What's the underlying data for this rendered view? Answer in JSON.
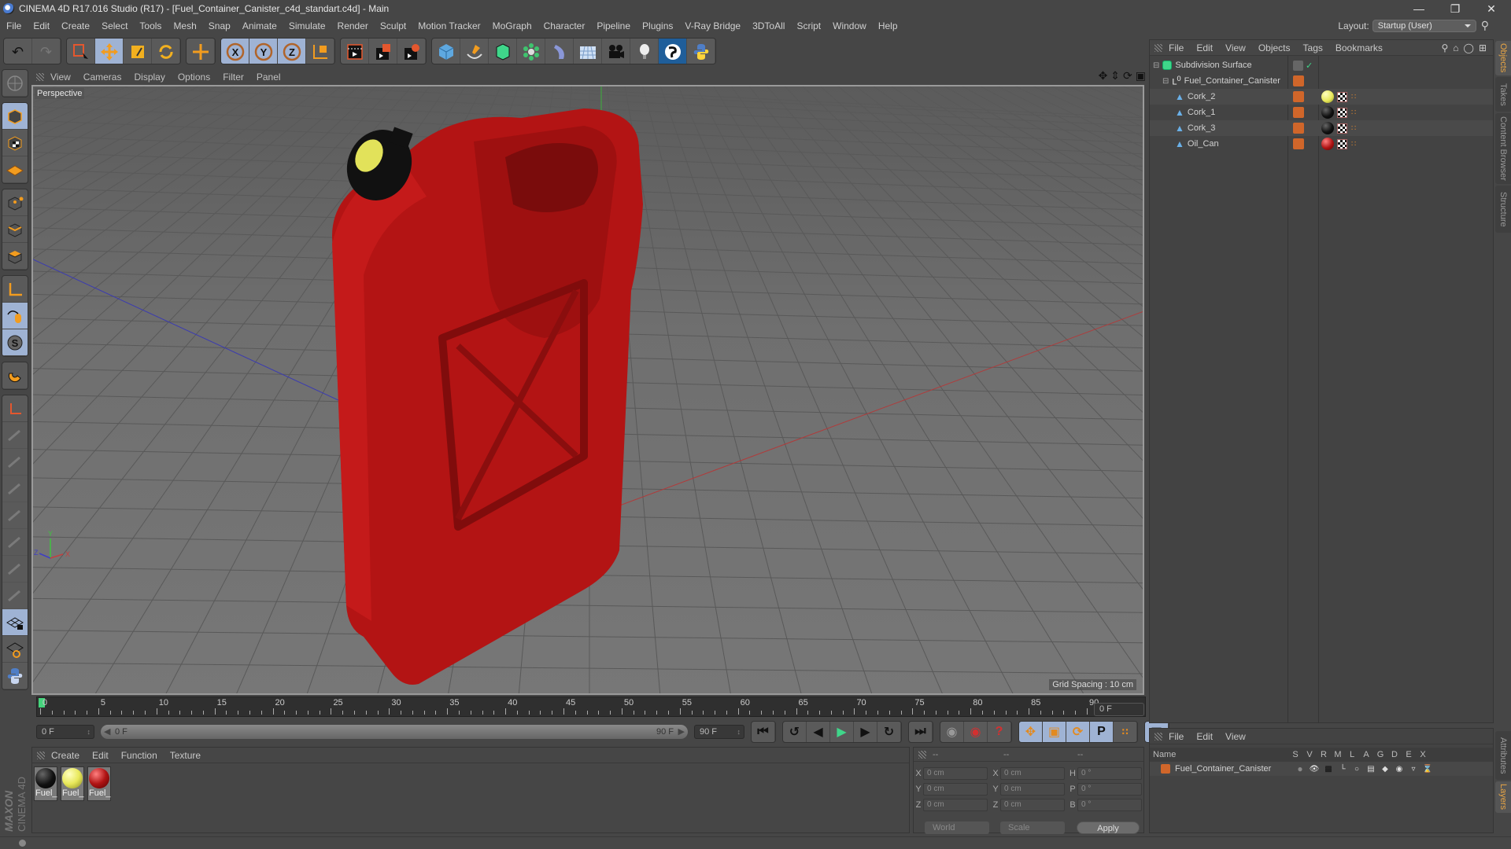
{
  "window": {
    "title": "CINEMA 4D R17.016 Studio (R17) - [Fuel_Container_Canister_c4d_standart.c4d] - Main",
    "controls": [
      "minimize",
      "restore",
      "close"
    ]
  },
  "menubar": [
    "File",
    "Edit",
    "Create",
    "Select",
    "Tools",
    "Mesh",
    "Snap",
    "Animate",
    "Simulate",
    "Render",
    "Sculpt",
    "Motion Tracker",
    "MoGraph",
    "Character",
    "Pipeline",
    "Plugins",
    "V-Ray Bridge",
    "3DToAll",
    "Script",
    "Window",
    "Help"
  ],
  "layout": {
    "label": "Layout:",
    "value": "Startup (User)"
  },
  "toolbar": {
    "groups": [
      [
        "undo-icon",
        "redo-icon"
      ],
      [
        "live-selection-icon",
        "move-icon",
        "scale-icon",
        "rotate-icon"
      ],
      [
        "move-plus-icon"
      ],
      [
        "x-axis-icon",
        "y-axis-icon",
        "z-axis-icon",
        "coordinate-system-icon"
      ],
      [
        "render-view-icon",
        "render-picture-viewer-icon",
        "render-settings-icon"
      ],
      [
        "cube-icon",
        "pen-spline-icon",
        "subdivision-icon",
        "array-icon",
        "deformer-icon",
        "floor-icon",
        "camera-icon",
        "light-icon",
        "sketch-icon",
        "python-icon"
      ]
    ]
  },
  "viewport": {
    "menu": [
      "View",
      "Cameras",
      "Display",
      "Options",
      "Filter",
      "Panel"
    ],
    "label": "Perspective",
    "grid_spacing": "Grid Spacing : 10 cm",
    "axis_labels": [
      "X",
      "Y",
      "Z"
    ]
  },
  "timeline": {
    "ticks": [
      0,
      5,
      10,
      15,
      20,
      25,
      30,
      35,
      40,
      45,
      50,
      55,
      60,
      65,
      70,
      75,
      80,
      85,
      90
    ],
    "current_frame": "0 F",
    "start_field": "0 F",
    "range_start": "0 F",
    "range_end": "90 F",
    "end_field": "90 F",
    "current_frame_right": "0 F"
  },
  "materials": {
    "menu": [
      "Create",
      "Edit",
      "Function",
      "Texture"
    ],
    "items": [
      {
        "name": "Fuel_",
        "color": "#111111"
      },
      {
        "name": "Fuel_",
        "color": "#e8e85a"
      },
      {
        "name": "Fuel_",
        "color": "#b01414"
      }
    ]
  },
  "coordinates": {
    "headers": [
      "--",
      "--",
      "--"
    ],
    "rows": [
      {
        "a": "X",
        "v1": "0 cm",
        "b": "X",
        "v2": "0 cm",
        "c": "H",
        "v3": "0 °"
      },
      {
        "a": "Y",
        "v1": "0 cm",
        "b": "Y",
        "v2": "0 cm",
        "c": "P",
        "v3": "0 °"
      },
      {
        "a": "Z",
        "v1": "0 cm",
        "b": "Z",
        "v2": "0 cm",
        "c": "B",
        "v3": "0 °"
      }
    ],
    "mode": "World",
    "transform": "Scale",
    "apply": "Apply"
  },
  "object_manager": {
    "menu": [
      "File",
      "Edit",
      "View",
      "Objects",
      "Tags",
      "Bookmarks"
    ],
    "objects": [
      {
        "name": "Subdivision Surface",
        "level": 0,
        "icon": "subdivision-icon"
      },
      {
        "name": "Fuel_Container_Canister",
        "level": 1,
        "icon": "null-icon"
      },
      {
        "name": "Cork_2",
        "level": 2,
        "icon": "polygon-icon",
        "material": "#e8e85a"
      },
      {
        "name": "Cork_1",
        "level": 2,
        "icon": "polygon-icon",
        "material": "#111111"
      },
      {
        "name": "Cork_3",
        "level": 2,
        "icon": "polygon-icon",
        "material": "#111111"
      },
      {
        "name": "Oil_Can",
        "level": 2,
        "icon": "polygon-icon",
        "material": "#b01414"
      }
    ]
  },
  "side_tabs_top": [
    "Objects",
    "Takes",
    "Content Browser",
    "Structure"
  ],
  "side_tabs_bottom": [
    "Attributes",
    "Layers"
  ],
  "layer_manager": {
    "menu": [
      "File",
      "Edit",
      "View"
    ],
    "columns": [
      "Name",
      "S",
      "V",
      "R",
      "M",
      "L",
      "A",
      "G",
      "D",
      "E",
      "X"
    ],
    "layers": [
      {
        "name": "Fuel_Container_Canister",
        "color": "#d0662a"
      }
    ]
  },
  "brand": {
    "maxon": "MAXON",
    "product": "CINEMA 4D"
  },
  "colors": {
    "accent": "#f29c1f",
    "active_tool": "#9fb3d4",
    "layer": "#d0662a",
    "canister": "#c01818"
  }
}
